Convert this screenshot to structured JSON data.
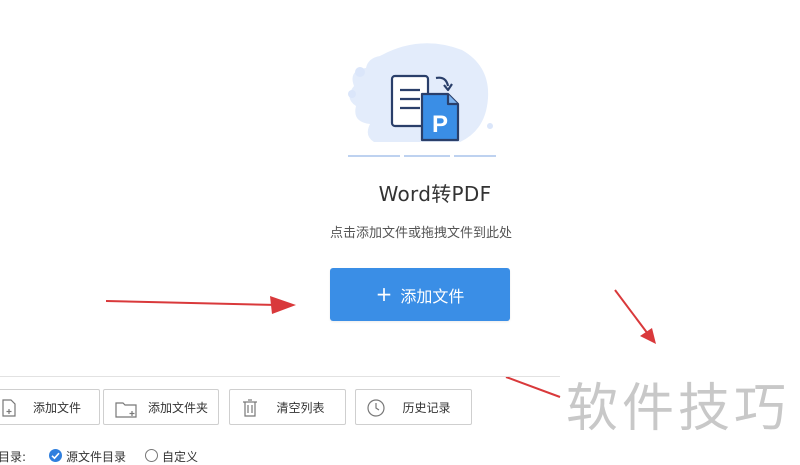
{
  "hero": {
    "title": "Word转PDF",
    "hint": "点击添加文件或拖拽文件到此处",
    "add_button_label": "添加文件",
    "add_button_plus": "+",
    "doc_letter": "P"
  },
  "toolbar": {
    "buttons": [
      {
        "label": "添加文件",
        "icon": "file-add-icon"
      },
      {
        "label": "添加文件夹",
        "icon": "folder-add-icon"
      },
      {
        "label": "清空列表",
        "icon": "trash-icon"
      },
      {
        "label": "历史记录",
        "icon": "clock-icon"
      }
    ]
  },
  "output": {
    "label": "目录:",
    "options": [
      {
        "label": "源文件目录",
        "selected": true
      },
      {
        "label": "自定义",
        "selected": false
      }
    ]
  },
  "watermark": "软件技巧",
  "colors": {
    "accent": "#3a8ee6",
    "annotation_arrow": "#d9393b",
    "illustration_bg": "#e3ecfb"
  }
}
